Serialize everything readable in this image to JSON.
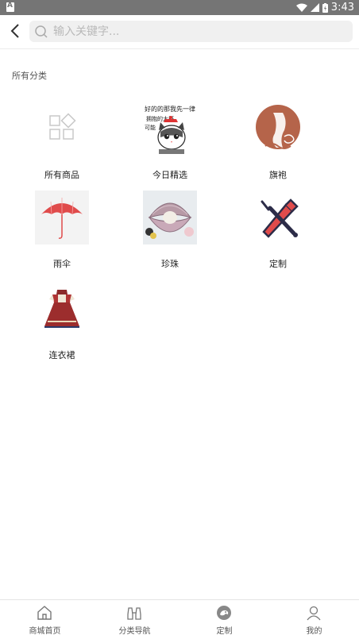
{
  "status_bar": {
    "time": "3:43"
  },
  "header": {
    "search_placeholder": "输入关键字..."
  },
  "section": {
    "title": "所有分类"
  },
  "categories": [
    {
      "label": "所有商品",
      "icon": "grid-icon"
    },
    {
      "label": "今日精选",
      "icon": "cat-sticker-image"
    },
    {
      "label": "旗袍",
      "icon": "qipao-logo-image"
    },
    {
      "label": "雨伞",
      "icon": "umbrella-image"
    },
    {
      "label": "珍珠",
      "icon": "pearl-shell-image"
    },
    {
      "label": "定制",
      "icon": "tools-icon"
    },
    {
      "label": "连衣裙",
      "icon": "dress-image"
    }
  ],
  "sticker_text": [
    "好的的那我先一律",
    "拥抱的大概",
    "可能"
  ],
  "bottom_nav": [
    {
      "label": "商城首页",
      "icon": "home-icon"
    },
    {
      "label": "分类导航",
      "icon": "binoculars-icon"
    },
    {
      "label": "定制",
      "icon": "custom-icon"
    },
    {
      "label": "我的",
      "icon": "user-icon"
    }
  ],
  "colors": {
    "accent_red": "#e04b4b",
    "brand_brown": "#b5644a"
  }
}
